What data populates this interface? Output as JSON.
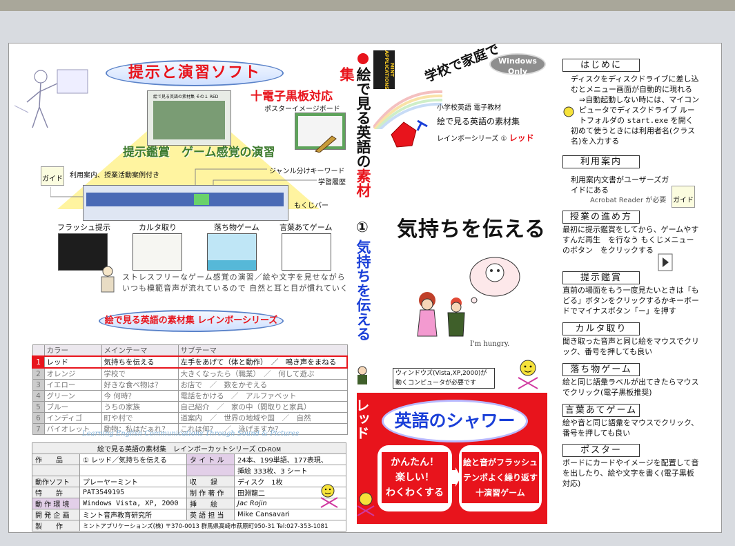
{
  "left": {
    "header_title": "提示と演習ソフト",
    "blackboard": "十電子黒板対応",
    "poster_caption": "ポスターイメージボード",
    "stage_title": "提示鑑賞　ゲーム感覚の演習",
    "shot_title": "絵で見る英語の素材集  その１ RED",
    "guide_note": "利用案内、授業活動案例付き",
    "guide_icon_label": "ガイド",
    "genre_label": "ジャンル分けキーワード",
    "history_label": "学習履歴",
    "menu_label": "もくじバー",
    "thumbs": [
      {
        "label": "フラッシュ提示"
      },
      {
        "label": "カルタ取り"
      },
      {
        "label": "落ち物ゲーム"
      },
      {
        "label": "言葉あてゲーム"
      }
    ],
    "description_line1": "ストレスフリーなゲーム感覚の演習／絵や文字を見せながら",
    "description_line2": "いつも模範音声が流れているので 自然と耳と目が慣れていく",
    "series_title": "絵で見る英語の素材集 レインボーシリーズ",
    "table_headers": [
      "",
      "カラー",
      "メインテーマ",
      "サブテーマ"
    ],
    "table_rows": [
      {
        "no": "1",
        "color": "レッド",
        "main": "気持ちを伝える",
        "sub": "左手をあげて（体と動作）　／　鳴き声をまねる"
      },
      {
        "no": "2",
        "color": "オレンジ",
        "main": "学校で",
        "sub": "大きくなったら（職業）　／　何して遊ぶ"
      },
      {
        "no": "3",
        "color": "イエロー",
        "main": "好きな食べ物は？",
        "sub": "お店で　／　数をかぞえる"
      },
      {
        "no": "4",
        "color": "グリーン",
        "main": "今 何時？",
        "sub": "電話をかける　／　アルファベット"
      },
      {
        "no": "5",
        "color": "ブルー",
        "main": "うちの家族",
        "sub": "自己紹介　／　家の中（間取りと家具）"
      },
      {
        "no": "6",
        "color": "インディゴ",
        "main": "町や村で",
        "sub": "道案内　／　世界の地域や国　／　自然"
      },
      {
        "no": "7",
        "color": "バイオレット",
        "main": "動物：私はだぁれ？",
        "sub": "これは何？　／　泳げますか？"
      }
    ],
    "tagline": "Learning English Communications Through Sound & Pictures",
    "info_header": "絵で見る英語の素材集　レインボーカットシリーズ",
    "info_header_media": "CD-ROM",
    "info": {
      "work_label": "作　　品",
      "work_value": "① レッド／気持ちを伝える",
      "title_label": "タ イ ト ル",
      "title_value": "24本、199単語、177表現、",
      "title_value2": "挿絵 333枚、3 シート",
      "soft_label": "動作ソフト",
      "soft_value": "プレーヤーミント",
      "rec_label": "収　　録",
      "rec_value": "ディスク　1枚",
      "patent_label": "特　　許",
      "patent_value": "PAT3549195",
      "author_label": "制 作 著 作",
      "author_value": "田淵龍二",
      "env_label": "動 作 環 境",
      "env_value": "Windows Vista, XP, 2000",
      "illust_label": "挿　　絵",
      "illust_value": "Jac Rojin",
      "dev_label": "開 発 企 画",
      "dev_value": "ミント音声教育研究所",
      "eng_label": "英 語 担 当",
      "eng_value": "Mike Cansavari",
      "maker_label": "製　　作",
      "maker_value": "ミントアプリケーションズ(株) 〒370-0013 群馬県高崎市萩原町950-31 Tel:027-353-1081"
    }
  },
  "middle": {
    "vertical_title_a": "絵で見る英語の",
    "vertical_title_b": "素材集",
    "vertical_num": "①",
    "vertical_sub": "気持ちを伝える",
    "logo_text": "MINT APPLICATIONS",
    "windows_only": "Windows Only",
    "school_home": "学校で家庭で",
    "grade": "小学校英語 電子教材",
    "series_name": "絵で見る英語の素材集",
    "series_line": "レインボーシリーズ ① ",
    "series_color": "レッド",
    "big_title": "気持ちを伝える",
    "caption": "I'm hungry.",
    "requirement_line1": "ウィンドウズ(Vista,XP,2000)が",
    "requirement_line2": "動くコンピュータが必要です",
    "red_label": "レッド",
    "shower_title": "英語のシャワー",
    "badge_left_1": "かんたん！",
    "badge_left_2": "楽しい！",
    "badge_left_3": "わくわくする",
    "badge_right_1": "絵と音がフラッシュ",
    "badge_right_2": "テンポよく繰り返す",
    "badge_right_3": "十演習ゲーム"
  },
  "right": {
    "sections": [
      {
        "heading": "はじめに",
        "body": "ディスクをディスクドライブに差し込むとメニュー画面が自動的に現れる\n　⇒自動起動しない時には、マイコンピュータでディスクドライブ ルートフォルダの start.exe を開く\n初めて使うときには利用者名(クラス名)を入力する"
      },
      {
        "heading": "利用案内",
        "body": "利用案内文書がユーザーズガイドにある\nAcrobat Reader が必要"
      },
      {
        "heading": "授業の進め方",
        "body": "最初に提示鑑賞をしてから、ゲームやすすんだ再生　を行なう\nもくじメニューのボタン　をクリックする"
      },
      {
        "heading": "提示鑑賞",
        "body": "直前の場面をもう一度見たいときは「もどる」ボタンをクリックするかキーボードでマイナスボタン「ー」を押す"
      },
      {
        "heading": "カルタ取り",
        "body": "聞き取った音声と同じ絵をマウスでクリック、番号を押しても良い"
      },
      {
        "heading": "落ち物ゲーム",
        "body": "絵と同じ語彙ラベルが出てきたらマウスでクリック(電子黒板推奨)"
      },
      {
        "heading": "言葉あてゲーム",
        "body": "絵や音と同じ語彙をマウスでクリック、番号を押しても良い"
      },
      {
        "heading": "ポスター",
        "body": "ボードにカードやイメージを配置して音を出したり、絵や文字を書く(電子黒板対応)"
      }
    ],
    "guide_icon_label": "ガイド"
  },
  "colors": {
    "red": "#e8141c",
    "blue": "#1a3fd8",
    "yellow": "#fff4a0",
    "page": "#ffffff"
  }
}
